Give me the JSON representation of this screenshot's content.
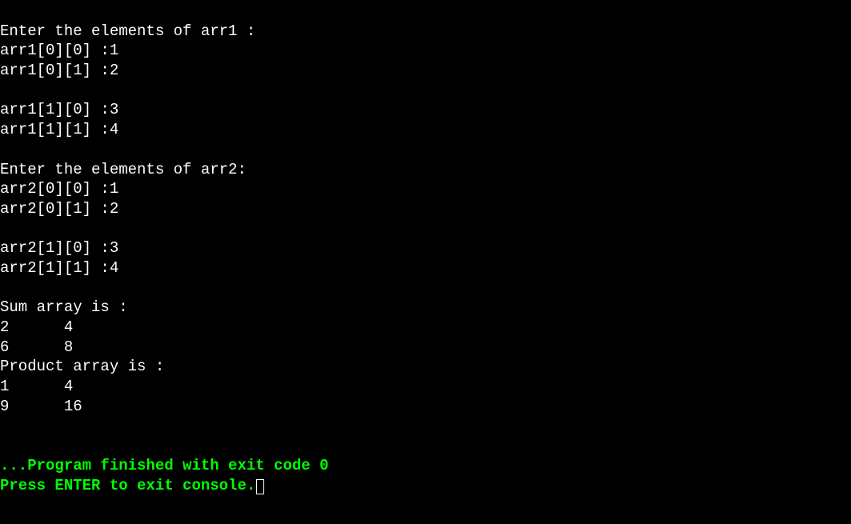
{
  "console": {
    "prompt_arr1": "Enter the elements of arr1 :",
    "arr1_00_label": "arr1[0][0] :",
    "arr1_00_value": "1",
    "arr1_01_label": "arr1[0][1] :",
    "arr1_01_value": "2",
    "arr1_10_label": "arr1[1][0] :",
    "arr1_10_value": "3",
    "arr1_11_label": "arr1[1][1] :",
    "arr1_11_value": "4",
    "prompt_arr2": "Enter the elements of arr2:",
    "arr2_00_label": "arr2[0][0] :",
    "arr2_00_value": "1",
    "arr2_01_label": "arr2[0][1] :",
    "arr2_01_value": "2",
    "arr2_10_label": "arr2[1][0] :",
    "arr2_10_value": "3",
    "arr2_11_label": "arr2[1][1] :",
    "arr2_11_value": "4",
    "sum_header": "Sum array is :",
    "sum_row0": "2      4",
    "sum_row1": "6      8",
    "product_header": "Product array is :",
    "product_row0": "1      4",
    "product_row1": "9      16",
    "exit_message": "...Program finished with exit code 0",
    "press_enter": "Press ENTER to exit console."
  }
}
